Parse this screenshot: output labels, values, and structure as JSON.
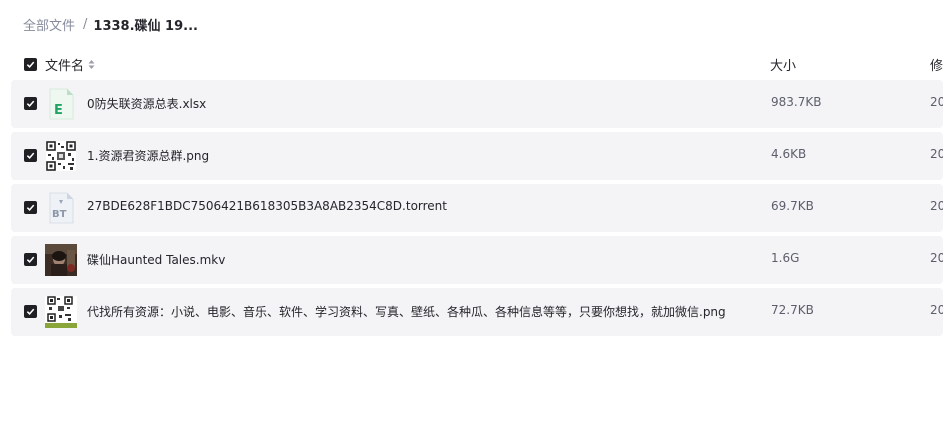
{
  "breadcrumb": {
    "root": "全部文件",
    "separator": "/",
    "current": "1338.碟仙 19..."
  },
  "table": {
    "headers": {
      "name": "文件名",
      "size": "大小",
      "modified": "修"
    },
    "rows": [
      {
        "name": "0防失联资源总表.xlsx",
        "size": "983.7KB",
        "modified": "20",
        "icon": "excel-file-icon"
      },
      {
        "name": "1.资源君资源总群.png",
        "size": "4.6KB",
        "modified": "20",
        "icon": "qr-code-image-icon"
      },
      {
        "name": "27BDE628F1BDC7506421B618305B3A8AB2354C8D.torrent",
        "size": "69.7KB",
        "modified": "20",
        "icon": "bt-torrent-file-icon"
      },
      {
        "name": "碟仙Haunted Tales.mkv",
        "size": "1.6G",
        "modified": "20",
        "icon": "video-thumbnail-icon"
      },
      {
        "name": "代找所有资源：小说、电影、音乐、软件、学习资料、写真、壁纸、各种瓜、各种信息等等，只要你想找，就加微信.png",
        "size": "72.7KB",
        "modified": "20",
        "icon": "qr-code-image-icon"
      }
    ]
  },
  "colors": {
    "row_bg": "#f4f4f6",
    "checkbox": "#1f1f24",
    "excel_green": "#1fa463",
    "muted_text": "#878c9c"
  }
}
